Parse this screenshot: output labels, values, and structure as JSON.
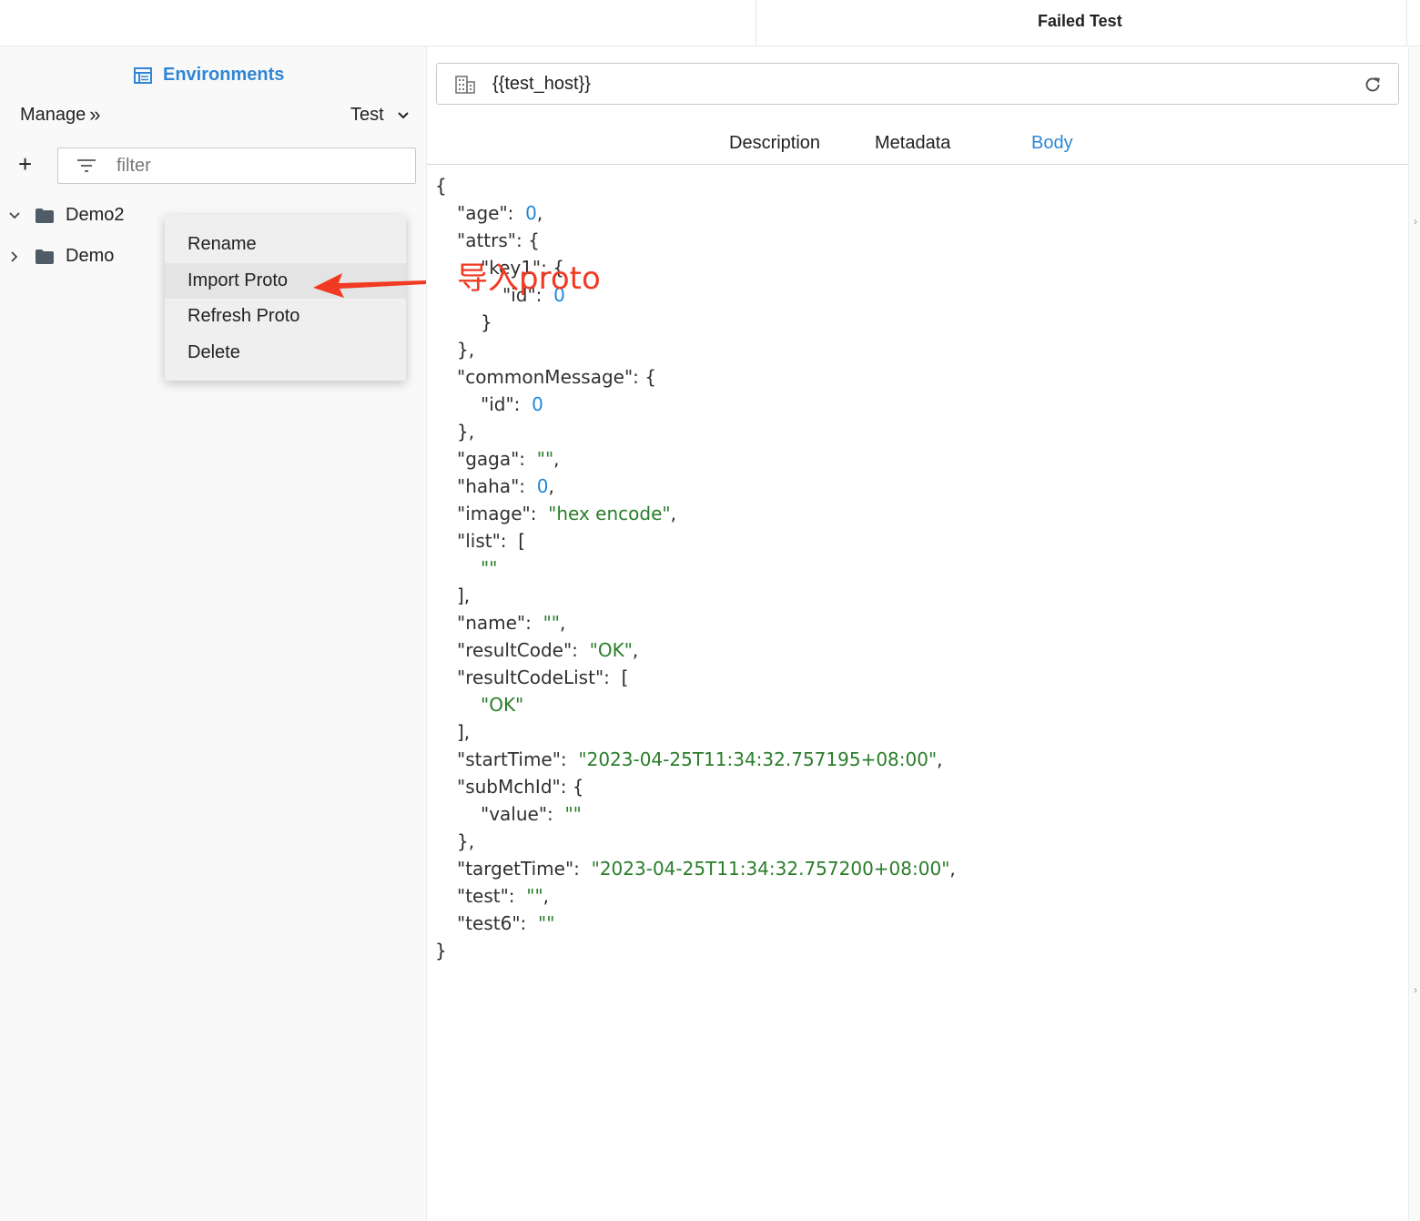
{
  "window": {
    "title": "Failed Test"
  },
  "sidebar": {
    "environments_label": "Environments",
    "manage_label": "Manage",
    "manage_chevron": "»",
    "env_select_value": "Test",
    "add_label": "+",
    "filter_placeholder": "filter",
    "tree": [
      {
        "label": "Demo2",
        "expanded": true
      },
      {
        "label": "Demo",
        "expanded": false
      }
    ]
  },
  "context_menu": {
    "items": [
      {
        "label": "Rename"
      },
      {
        "label": "Import Proto"
      },
      {
        "label": "Refresh Proto"
      },
      {
        "label": "Delete"
      }
    ]
  },
  "request": {
    "url": "{{test_host}}"
  },
  "tabs": [
    {
      "label": "Description"
    },
    {
      "label": "Metadata"
    },
    {
      "label": "Body"
    }
  ],
  "annotation": {
    "text": "导入proto"
  },
  "body_json": {
    "age": "0",
    "key1_id": "0",
    "common_message_id": "0",
    "gaga": "\"\"",
    "haha": "0",
    "image": "\"hex encode\"",
    "list_item": "\"\"",
    "name": "\"\"",
    "resultCode": "\"OK\"",
    "resultCodeList_item": "\"OK\"",
    "startTime": "\"2023-04-25T11:34:32.757195+08:00\"",
    "subMchId_value": "\"\"",
    "targetTime": "\"2023-04-25T11:34:32.757200+08:00\"",
    "test": "\"\"",
    "test6": "\"\""
  },
  "colors": {
    "accent": "#2f86d6",
    "annotation": "#f03a22",
    "string": "#2a7d2a",
    "number": "#1f88d8"
  }
}
